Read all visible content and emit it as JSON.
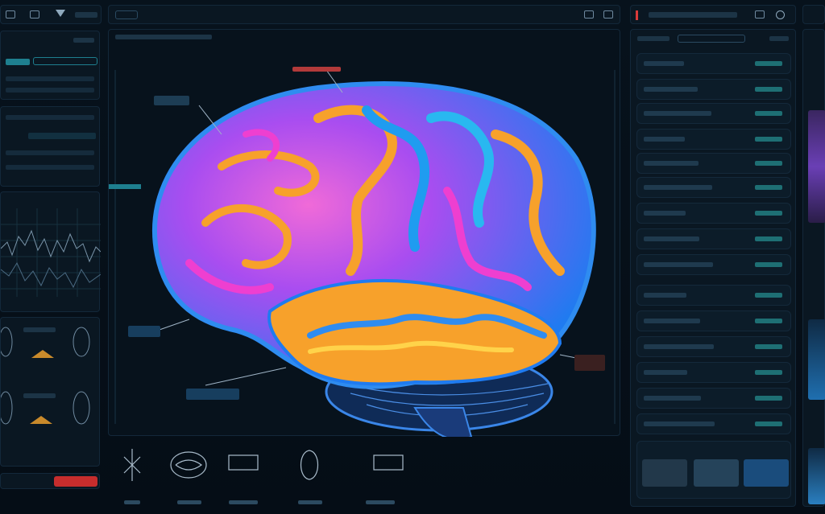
{
  "topbar": {
    "left_icon_1": "grid-icon",
    "left_icon_2": "layers-icon",
    "left_icon_3": "filter-icon",
    "search": {
      "placeholder": ""
    },
    "center_icon_1": "camera-icon",
    "center_icon_2": "settings-icon",
    "right_title": "",
    "right_icon_1": "pin-icon",
    "right_icon_2": "user-icon"
  },
  "left_panel": {
    "sections": [
      {
        "label": "",
        "value": ""
      },
      {
        "label": "",
        "value": ""
      },
      {
        "label": "",
        "value": ""
      }
    ],
    "graph_label": "",
    "bottom_button": ""
  },
  "viewer": {
    "header": "",
    "annotations": [
      {
        "id": "label-top",
        "text": ""
      },
      {
        "id": "label-left-upper",
        "text": ""
      },
      {
        "id": "label-left-lower",
        "text": ""
      },
      {
        "id": "label-bottom",
        "text": ""
      },
      {
        "id": "label-right",
        "text": ""
      }
    ],
    "thumbnails": [
      {
        "name": "skeleton-icon"
      },
      {
        "name": "brain-icon"
      },
      {
        "name": "scan-icon"
      },
      {
        "name": "head-icon"
      },
      {
        "name": "chart-icon"
      }
    ]
  },
  "right_panel": {
    "header": "",
    "rows": [
      {
        "label": "",
        "value": ""
      },
      {
        "label": "",
        "value": ""
      },
      {
        "label": "",
        "value": ""
      },
      {
        "label": "",
        "value": ""
      },
      {
        "label": "",
        "value": ""
      },
      {
        "label": "",
        "value": ""
      },
      {
        "label": "",
        "value": ""
      },
      {
        "label": "",
        "value": ""
      },
      {
        "label": "",
        "value": ""
      },
      {
        "label": "",
        "value": ""
      },
      {
        "label": "",
        "value": ""
      },
      {
        "label": "",
        "value": ""
      },
      {
        "label": "",
        "value": ""
      },
      {
        "label": "",
        "value": ""
      },
      {
        "label": "",
        "value": ""
      }
    ]
  },
  "colors": {
    "accent": "#2ec4b6",
    "alert": "#d93a3a",
    "brain_magenta": "#ee3fd0",
    "brain_blue": "#1f7bf0",
    "brain_orange": "#f7a12b"
  }
}
